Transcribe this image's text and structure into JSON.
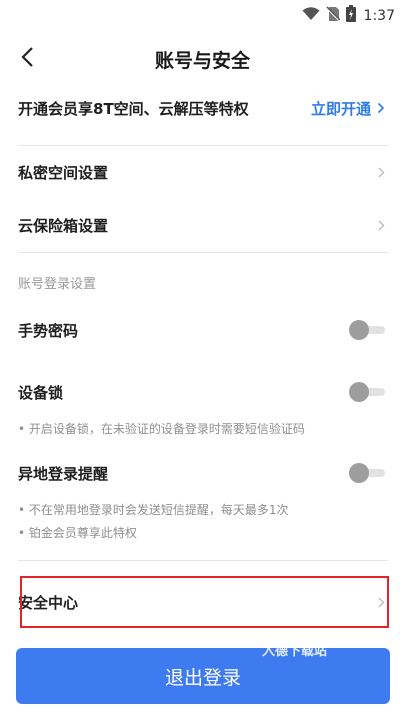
{
  "status_bar": {
    "time": "1:37",
    "icons": [
      "wifi-icon",
      "no-sim-icon",
      "battery-icon"
    ]
  },
  "header": {
    "title": "账号与安全",
    "back_icon": "chevron-left-icon"
  },
  "vip_banner": {
    "text": "开通会员享8T空间、云解压等特权",
    "action_label": "立即开通"
  },
  "settings": {
    "private_space": "私密空间设置",
    "cloud_safe": "云保险箱设置"
  },
  "login_section": {
    "heading": "账号登录设置",
    "gesture_password": {
      "label": "手势密码",
      "enabled": false
    },
    "device_lock": {
      "label": "设备锁",
      "enabled": false,
      "note": "• 开启设备锁，在未验证的设备登录时需要短信验证码"
    },
    "remote_login_alert": {
      "label": "异地登录提醒",
      "enabled": false,
      "notes": [
        "• 不在常用地登录时会发送短信提醒，每天最多1次",
        "• 铂金会员尊享此特权"
      ]
    }
  },
  "security_center": {
    "label": "安全中心"
  },
  "logout": {
    "label": "退出登录"
  },
  "watermark": "入德下载站",
  "colors": {
    "accent": "#3f7bf0",
    "link": "#2f7bea",
    "highlight": "#e3232c",
    "toggle_off": "#9d9d9d"
  }
}
